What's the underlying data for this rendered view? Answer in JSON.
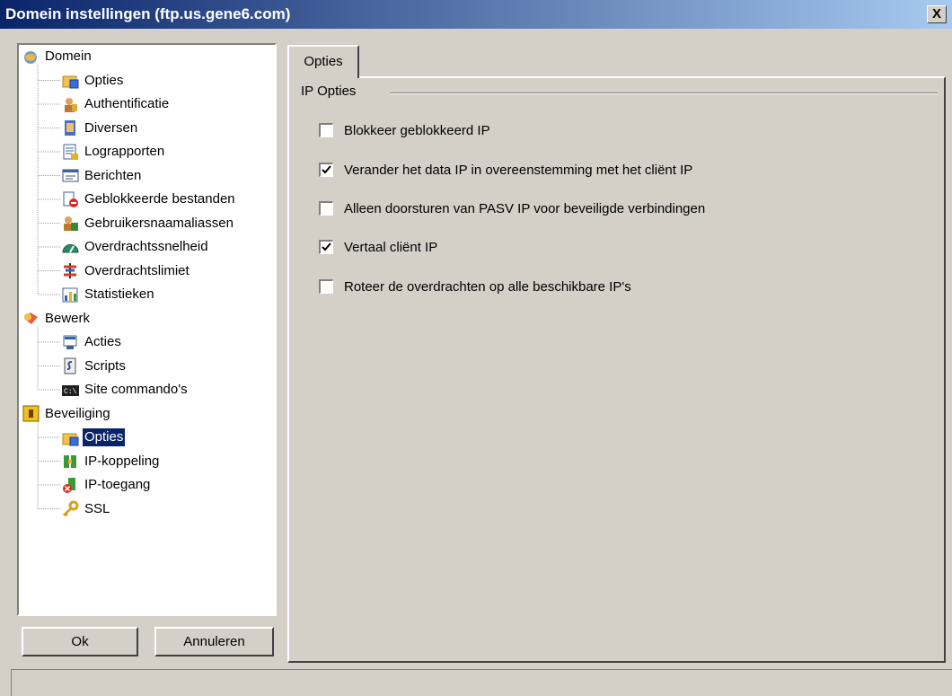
{
  "window": {
    "title": "Domein instellingen (ftp.us.gene6.com)",
    "close_label": "X"
  },
  "tree": {
    "items": [
      {
        "label": "Domein",
        "icon": "domain-globe-icon",
        "level": 0
      },
      {
        "label": "Opties",
        "icon": "options-icon",
        "level": 1
      },
      {
        "label": "Authentificatie",
        "icon": "authentication-icon",
        "level": 1
      },
      {
        "label": "Diversen",
        "icon": "misc-icon",
        "level": 1
      },
      {
        "label": "Lograpporten",
        "icon": "log-report-icon",
        "level": 1
      },
      {
        "label": "Berichten",
        "icon": "messages-icon",
        "level": 1
      },
      {
        "label": "Geblokkeerde bestanden",
        "icon": "blocked-files-icon",
        "level": 1
      },
      {
        "label": "Gebruikersnaamaliassen",
        "icon": "user-alias-icon",
        "level": 1
      },
      {
        "label": "Overdrachtssnelheid",
        "icon": "speed-gauge-icon",
        "level": 1
      },
      {
        "label": "Overdrachtslimiet",
        "icon": "limit-icon",
        "level": 1
      },
      {
        "label": "Statistieken",
        "icon": "statistics-icon",
        "level": 1
      },
      {
        "label": "Bewerk",
        "icon": "edit-icon",
        "level": 0
      },
      {
        "label": "Acties",
        "icon": "actions-icon",
        "level": 1
      },
      {
        "label": "Scripts",
        "icon": "scripts-icon",
        "level": 1
      },
      {
        "label": "Site commando's",
        "icon": "console-icon",
        "level": 1
      },
      {
        "label": "Beveiliging",
        "icon": "security-lock-icon",
        "level": 0
      },
      {
        "label": "Opties",
        "icon": "options-icon",
        "level": 1,
        "selected": true
      },
      {
        "label": "IP-koppeling",
        "icon": "ip-binding-icon",
        "level": 1
      },
      {
        "label": "IP-toegang",
        "icon": "ip-access-icon",
        "level": 1
      },
      {
        "label": "SSL",
        "icon": "key-icon",
        "level": 1
      }
    ]
  },
  "buttons": {
    "ok": "Ok",
    "cancel": "Annuleren"
  },
  "tab": {
    "label": "Opties"
  },
  "group": {
    "label": "IP Opties"
  },
  "options": [
    {
      "label": "Blokkeer geblokkeerd IP",
      "checked": false
    },
    {
      "label": "Verander het data IP in overeenstemming met het cliënt IP",
      "checked": true
    },
    {
      "label": "Alleen doorsturen van PASV IP voor beveiligde verbindingen",
      "checked": false
    },
    {
      "label": "Vertaal cliënt IP",
      "checked": true
    },
    {
      "label": "Roteer de overdrachten op alle beschikbare IP's",
      "checked": false
    }
  ],
  "colors": {
    "title_start": "#0a246a",
    "title_end": "#a6caf0",
    "selection": "#0a246a",
    "face": "#d4d0c8"
  }
}
